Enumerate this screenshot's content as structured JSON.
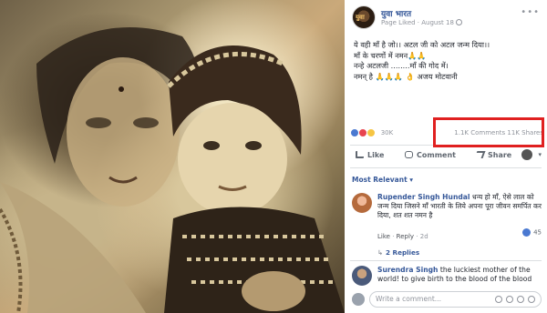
{
  "photo": {
    "alt": "Vintage photograph of a mother holding a baby"
  },
  "page": {
    "name": "युवा भारत",
    "liked_label": "Page Liked",
    "date": "August 18",
    "separator": " · "
  },
  "post": {
    "lines": [
      "ये वही माँ है जो।। अटल जी को अटल जन्म दिया।।",
      "माँ के चरणों में नमन🙏🙏",
      "नन्हे अटलजी ........माँ की गोद में।",
      "नमन् है 🙏🙏🙏 👌 अजय मोटवानी"
    ]
  },
  "stats": {
    "reactions": "30K",
    "comments": "1.1K Comments",
    "shares": "11K Shares"
  },
  "actions": {
    "like": "Like",
    "comment": "Comment",
    "share": "Share",
    "caret": "▾"
  },
  "sort": {
    "label": "Most Relevant ▾"
  },
  "comments": [
    {
      "name": "Rupender Singh Hundal",
      "text": "धन्य हो माँ, ऐसे लाल को जन्म दिया जिसने माँ भारती के लिये अपना पूरा जीवन समर्पित कर दिया, शत शत नमन है",
      "like": "Like",
      "reply": "Reply",
      "sep": " · ",
      "age": "2d",
      "likes": "45",
      "replies": "2 Replies"
    },
    {
      "name": "Surendra Singh",
      "text": "the luckiest mother of the world! to give birth to the blood of the blood"
    }
  ],
  "write": {
    "placeholder": "Write a comment..."
  },
  "colors": {
    "link": "#365899",
    "highlight": "#e02020",
    "like_blue": "#4a79d1"
  }
}
